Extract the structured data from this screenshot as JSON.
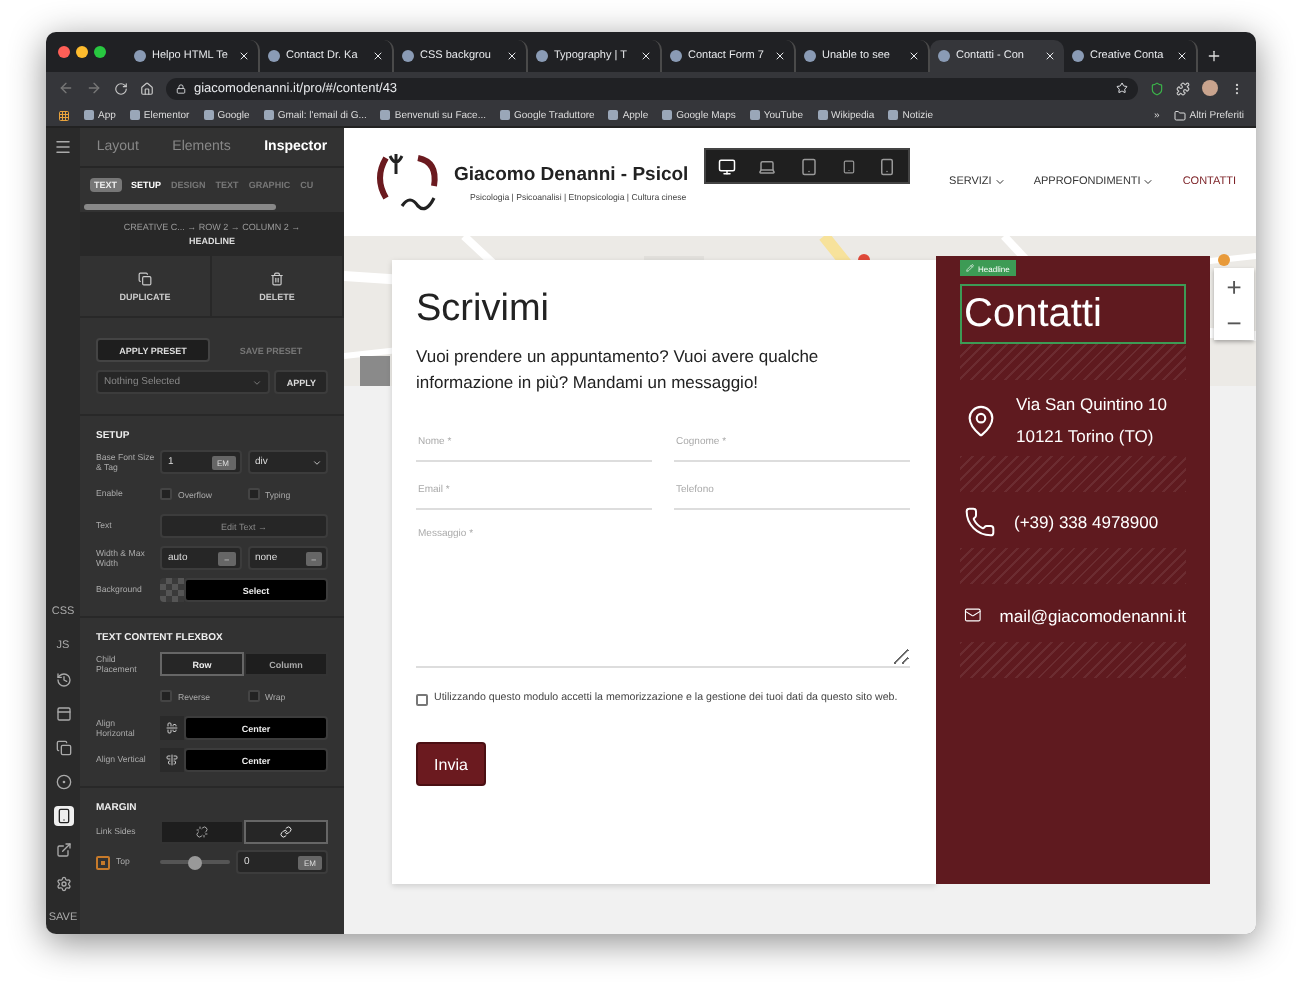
{
  "browser": {
    "tabs": [
      {
        "title": "Helpo HTML Te",
        "selected": false
      },
      {
        "title": "Contact Dr. Ka",
        "selected": false
      },
      {
        "title": "CSS backgrou",
        "selected": false
      },
      {
        "title": "Typography | T",
        "selected": false
      },
      {
        "title": "Contact Form 7",
        "selected": false
      },
      {
        "title": "Unable to see",
        "selected": false
      },
      {
        "title": "Contatti - Con",
        "selected": true
      },
      {
        "title": "Creative Conta",
        "selected": false
      }
    ],
    "address": "giacomodenanni.it/pro/#/content/43",
    "bookmarks": [
      "App",
      "Elementor",
      "Google",
      "Gmail: l'email di G...",
      "Benvenuti su Face...",
      "Google Traduttore",
      "Apple",
      "Google Maps",
      "YouTube",
      "Wikipedia",
      "Notizie"
    ],
    "more_bookmarks": "»",
    "other_bookmarks": "Altri Preferiti"
  },
  "rail": {
    "items": [
      {
        "kind": "text",
        "label": "CSS",
        "selected": false
      },
      {
        "kind": "text",
        "label": "JS",
        "selected": false
      },
      {
        "kind": "icon",
        "selected": false
      },
      {
        "kind": "icon",
        "selected": false
      },
      {
        "kind": "icon",
        "selected": false
      },
      {
        "kind": "icon",
        "selected": false
      },
      {
        "kind": "icon",
        "selected": true
      },
      {
        "kind": "icon",
        "selected": false
      },
      {
        "kind": "icon",
        "selected": false
      }
    ],
    "save": "SAVE"
  },
  "inspector": {
    "tabs": [
      {
        "label": "Layout",
        "selected": false
      },
      {
        "label": "Elements",
        "selected": false
      },
      {
        "label": "Inspector",
        "selected": true
      }
    ],
    "element_badge": "TEXT",
    "subtabs": [
      {
        "label": "SETUP",
        "selected": true
      },
      {
        "label": "DESIGN",
        "selected": false
      },
      {
        "label": "TEXT",
        "selected": false
      },
      {
        "label": "GRAPHIC",
        "selected": false
      },
      {
        "label": "CU",
        "selected": false
      }
    ],
    "breadcrumb": "CREATIVE C... → ROW 2 → COLUMN 2 →",
    "breadcrumb_current": "HEADLINE",
    "actions": [
      "DUPLICATE",
      "DELETE"
    ],
    "preset_tabs": [
      {
        "label": "APPLY PRESET",
        "selected": true
      },
      {
        "label": "SAVE PRESET",
        "selected": false
      }
    ],
    "preset_select": "Nothing Selected",
    "apply": "APPLY",
    "setup": {
      "title": "SETUP",
      "font_label": "Base Font Size & Tag",
      "font_size": "1",
      "font_unit": "EM",
      "tag": "div",
      "enable_label": "Enable",
      "enable": [
        {
          "label": "Overflow",
          "checked": false
        },
        {
          "label": "Typing",
          "checked": false
        }
      ],
      "text_label": "Text",
      "text_button": "Edit Text →",
      "width_label": "Width & Max Width",
      "width": "auto",
      "width_unit": "–",
      "max_width": "none",
      "max_width_unit": "–",
      "background_label": "Background",
      "background_button": "Select"
    },
    "flexbox": {
      "title": "TEXT CONTENT FLEXBOX",
      "placement_label": "Child Placement",
      "placement": [
        {
          "label": "Row",
          "selected": true
        },
        {
          "label": "Column",
          "selected": false
        }
      ],
      "options": [
        {
          "label": "Reverse",
          "checked": false
        },
        {
          "label": "Wrap",
          "checked": false
        }
      ],
      "align": [
        {
          "label": "Align Horizontal",
          "value": "Center"
        },
        {
          "label": "Align Vertical",
          "value": "Center"
        }
      ]
    },
    "margin": {
      "title": "MARGIN",
      "link_label": "Link Sides",
      "link_sides": [
        {
          "selected": false
        },
        {
          "selected": true
        }
      ],
      "top_label": "Top",
      "top_checked": true,
      "level": 0.5,
      "top_value": "0",
      "top_unit": "EM"
    }
  },
  "site": {
    "title": "Giacomo Denanni - Psicol",
    "tagline": "Psicologia | Psicoanalisi | Etnopsicologia | Cultura cinese",
    "devices": [
      {
        "selected": true
      },
      {
        "selected": false
      },
      {
        "selected": false
      },
      {
        "selected": false
      },
      {
        "selected": false
      }
    ],
    "nav": [
      {
        "label": "SERVIZI",
        "dropdown": true,
        "selected": false
      },
      {
        "label": "APPROFONDIMENTI",
        "dropdown": true,
        "selected": false
      },
      {
        "label": "CONTATTI",
        "dropdown": false,
        "selected": true
      }
    ]
  },
  "map": {
    "kind": "picture",
    "zoom": [
      "+",
      "−"
    ]
  },
  "form": {
    "title": "Scrivimi",
    "intro": "Vuoi prendere un appuntamento? Vuoi avere qualche informazione in più?  Mandami un messaggio!",
    "fields": [
      {
        "placeholder": "Nome *"
      },
      {
        "placeholder": "Cognome *"
      },
      {
        "placeholder": "Email *"
      },
      {
        "placeholder": "Telefono"
      }
    ],
    "message": {
      "placeholder": "Messaggio *"
    },
    "consent": {
      "label": "Utilizzando questo modulo accetti la memorizzazione e la gestione dei tuoi dati da questo sito web.",
      "checked": false
    },
    "submit": "Invia"
  },
  "contact": {
    "badge": "Headline",
    "title": "Contatti",
    "items": [
      {
        "kind": "address",
        "lines": [
          "Via San Quintino 10",
          "10121 Torino (TO)"
        ]
      },
      {
        "kind": "phone",
        "lines": [
          "(+39) 338 4978900"
        ]
      },
      {
        "kind": "mail",
        "lines": [
          "mail@giacomodenanni.it"
        ]
      }
    ]
  }
}
